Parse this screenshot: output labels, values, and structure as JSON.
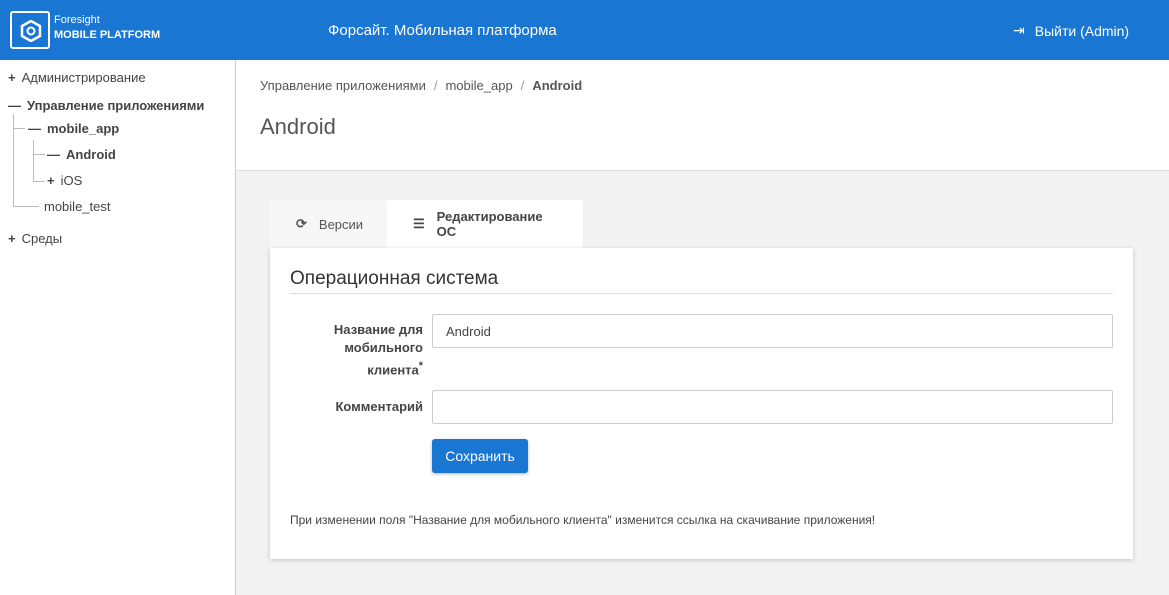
{
  "header": {
    "brand_top": "Foresight",
    "brand_bottom": "MOBILE PLATFORM",
    "title": "Форсайт. Мобильная платформа",
    "logout": "Выйти (Admin)"
  },
  "sidebar": {
    "items": [
      {
        "label": "Администрирование"
      },
      {
        "label": "Управление приложениями"
      },
      {
        "label": "mobile_app"
      },
      {
        "label": "Android"
      },
      {
        "label": "iOS"
      },
      {
        "label": "mobile_test"
      },
      {
        "label": "Среды"
      }
    ]
  },
  "breadcrumb": [
    "Управление приложениями",
    "mobile_app",
    "Android"
  ],
  "page_title": "Android",
  "tabs": [
    {
      "label": "Версии"
    },
    {
      "label": "Редактирование ОС"
    }
  ],
  "form": {
    "title": "Операционная система",
    "name_label": "Название для мобильного клиента",
    "required_mark": "*",
    "name_value": "Android",
    "comment_label": "Комментарий",
    "comment_value": "",
    "save": "Сохранить",
    "note": "При изменении поля \"Название для мобильного клиента\" изменится ссылка на скачивание приложения!"
  }
}
